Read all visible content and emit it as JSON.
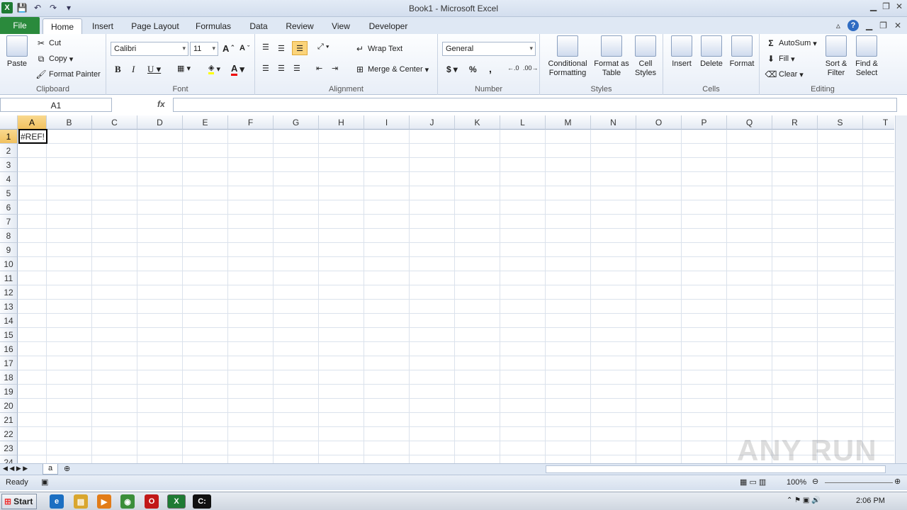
{
  "window": {
    "title": "Book1 - Microsoft Excel"
  },
  "tabs": [
    "File",
    "Home",
    "Insert",
    "Page Layout",
    "Formulas",
    "Data",
    "Review",
    "View",
    "Developer"
  ],
  "clipboard": {
    "paste": "Paste",
    "cut": "Cut",
    "copy": "Copy",
    "format_painter": "Format Painter",
    "label": "Clipboard"
  },
  "font": {
    "name": "Calibri",
    "size": "11",
    "label": "Font"
  },
  "alignment": {
    "wrap": "Wrap Text",
    "merge": "Merge & Center",
    "label": "Alignment"
  },
  "number": {
    "format": "General",
    "label": "Number",
    "currency": "$",
    "percent": "%",
    "comma": ","
  },
  "styles": {
    "conditional": "Conditional Formatting",
    "as_table": "Format as Table",
    "cell_styles": "Cell Styles",
    "label": "Styles"
  },
  "cells": {
    "insert": "Insert",
    "delete": "Delete",
    "format": "Format",
    "label": "Cells"
  },
  "editing": {
    "autosum": "AutoSum",
    "fill": "Fill",
    "clear": "Clear",
    "sort": "Sort & Filter",
    "find": "Find & Select",
    "label": "Editing"
  },
  "formula_bar": {
    "name_box": "A1",
    "fx": "fx",
    "formula": ""
  },
  "columns": [
    "A",
    "B",
    "C",
    "D",
    "E",
    "F",
    "G",
    "H",
    "I",
    "J",
    "K",
    "L",
    "M",
    "N",
    "O",
    "P",
    "Q",
    "R",
    "S",
    "T"
  ],
  "rows": [
    "1",
    "2",
    "3",
    "4",
    "5",
    "6",
    "7",
    "8",
    "9",
    "10",
    "11",
    "12",
    "13",
    "14",
    "15",
    "16",
    "17",
    "18",
    "19",
    "20",
    "21",
    "22",
    "23",
    "24"
  ],
  "cell_a1": "#REF!",
  "sheet": {
    "tab": "a"
  },
  "status": {
    "ready": "Ready",
    "zoom": "100%"
  },
  "taskbar": {
    "start": "Start",
    "time": "2:06 PM"
  },
  "watermark": "ANY RUN"
}
